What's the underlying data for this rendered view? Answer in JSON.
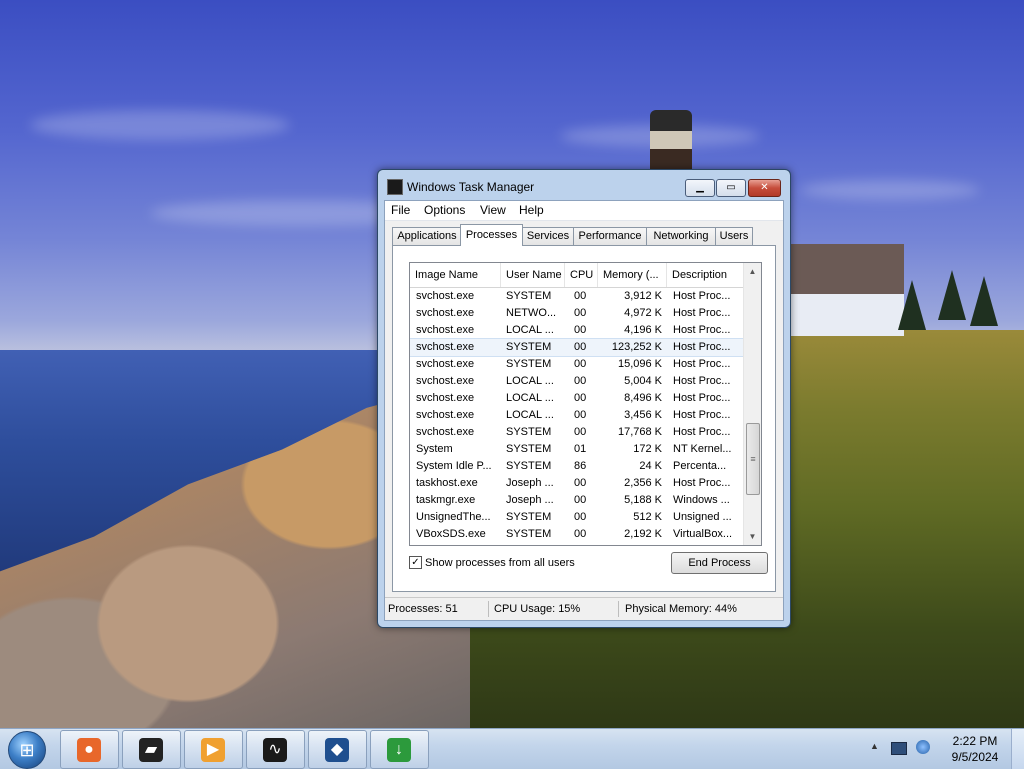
{
  "window": {
    "title": "Windows Task Manager",
    "buttons": {
      "minimize": "▁",
      "maximize": "▭",
      "close": "✕"
    }
  },
  "menu": [
    "File",
    "Options",
    "View",
    "Help"
  ],
  "tabs": [
    "Applications",
    "Processes",
    "Services",
    "Performance",
    "Networking",
    "Users"
  ],
  "active_tab": "Processes",
  "columns": [
    "Image Name",
    "User Name",
    "CPU",
    "Memory (...",
    "Description"
  ],
  "processes": [
    {
      "name": "svchost.exe",
      "user": "SYSTEM",
      "cpu": "00",
      "memory": "3,912 K",
      "desc": "Host Proc..."
    },
    {
      "name": "svchost.exe",
      "user": "NETWO...",
      "cpu": "00",
      "memory": "4,972 K",
      "desc": "Host Proc..."
    },
    {
      "name": "svchost.exe",
      "user": "LOCAL ...",
      "cpu": "00",
      "memory": "4,196 K",
      "desc": "Host Proc..."
    },
    {
      "name": "svchost.exe",
      "user": "SYSTEM",
      "cpu": "00",
      "memory": "123,252 K",
      "desc": "Host Proc..."
    },
    {
      "name": "svchost.exe",
      "user": "SYSTEM",
      "cpu": "00",
      "memory": "15,096 K",
      "desc": "Host Proc..."
    },
    {
      "name": "svchost.exe",
      "user": "LOCAL ...",
      "cpu": "00",
      "memory": "5,004 K",
      "desc": "Host Proc..."
    },
    {
      "name": "svchost.exe",
      "user": "LOCAL ...",
      "cpu": "00",
      "memory": "8,496 K",
      "desc": "Host Proc..."
    },
    {
      "name": "svchost.exe",
      "user": "LOCAL ...",
      "cpu": "00",
      "memory": "3,456 K",
      "desc": "Host Proc..."
    },
    {
      "name": "svchost.exe",
      "user": "SYSTEM",
      "cpu": "00",
      "memory": "17,768 K",
      "desc": "Host Proc..."
    },
    {
      "name": "System",
      "user": "SYSTEM",
      "cpu": "01",
      "memory": "172 K",
      "desc": "NT Kernel..."
    },
    {
      "name": "System Idle P...",
      "user": "SYSTEM",
      "cpu": "86",
      "memory": "24 K",
      "desc": "Percenta..."
    },
    {
      "name": "taskhost.exe",
      "user": "Joseph ...",
      "cpu": "00",
      "memory": "2,356 K",
      "desc": "Host Proc..."
    },
    {
      "name": "taskmgr.exe",
      "user": "Joseph ...",
      "cpu": "00",
      "memory": "5,188 K",
      "desc": "Windows ..."
    },
    {
      "name": "UnsignedThe...",
      "user": "SYSTEM",
      "cpu": "00",
      "memory": "512 K",
      "desc": "Unsigned ..."
    },
    {
      "name": "VBoxSDS.exe",
      "user": "SYSTEM",
      "cpu": "00",
      "memory": "2,192 K",
      "desc": "VirtualBox..."
    }
  ],
  "selected_row": 3,
  "show_all_label": "Show processes from all users",
  "show_all_checked": true,
  "check_mark": "✓",
  "end_process_label": "End Process",
  "status": {
    "processes": "Processes: 51",
    "cpu": "CPU Usage: 15%",
    "memory": "Physical Memory: 44%"
  },
  "scroll": {
    "up": "▲",
    "down": "▼",
    "grip": "≡"
  },
  "taskbar": {
    "apps": [
      {
        "icon": "firefox-icon",
        "glyph": "●",
        "color": "#e8672a"
      },
      {
        "icon": "terminal-icon",
        "glyph": "▰",
        "color": "#222222"
      },
      {
        "icon": "media-player-icon",
        "glyph": "▶",
        "color": "#f0a030"
      },
      {
        "icon": "task-manager-icon",
        "glyph": "∿",
        "color": "#1a1a1a"
      },
      {
        "icon": "virtualbox-icon",
        "glyph": "◆",
        "color": "#1f4f8f"
      },
      {
        "icon": "download-manager-icon",
        "glyph": "↓",
        "color": "#2c9a3c"
      }
    ],
    "tray_arrow": "▲",
    "time": "2:22 PM",
    "date": "9/5/2024"
  },
  "start_glyph": "⊞"
}
